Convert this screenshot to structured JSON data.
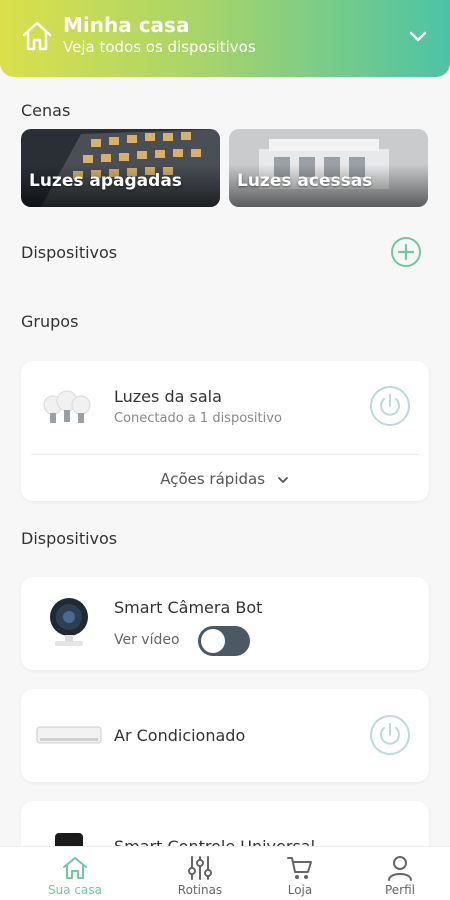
{
  "header": {
    "title": "Minha casa",
    "subtitle": "Veja todos os dispositivos"
  },
  "scenes": {
    "label": "Cenas",
    "items": [
      {
        "label": "Luzes apagadas"
      },
      {
        "label": "Luzes acessas"
      }
    ]
  },
  "dispositivos_header": {
    "label": "Dispositivos"
  },
  "groups": {
    "label": "Grupos",
    "items": [
      {
        "name": "Luzes da sala",
        "status": "Conectado a 1 dispositivo"
      }
    ],
    "quick_actions": "Ações rápidas"
  },
  "devices": {
    "label": "Dispositivos",
    "items": [
      {
        "name": "Smart Câmera Bot",
        "action": "Ver vídeo"
      },
      {
        "name": "Ar Condicionado"
      },
      {
        "name": "Smart Controle Universal"
      }
    ]
  },
  "nav": {
    "items": [
      {
        "label": "Sua casa"
      },
      {
        "label": "Rotinas"
      },
      {
        "label": "Loja"
      },
      {
        "label": "Perfil"
      }
    ]
  },
  "colors": {
    "accent": "#6fc8a0",
    "toggle_bg": "#4a5963",
    "power_ring": "#b9dcd9"
  }
}
